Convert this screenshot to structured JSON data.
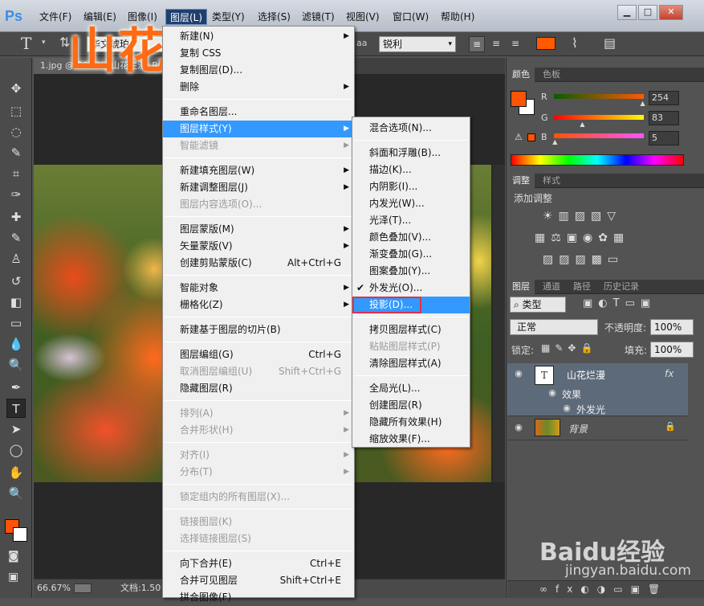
{
  "app": {
    "logo": "Ps"
  },
  "menubar": {
    "items": [
      "文件(F)",
      "编辑(E)",
      "图像(I)",
      "图层(L)",
      "类型(Y)",
      "选择(S)",
      "滤镜(T)",
      "视图(V)",
      "窗口(W)",
      "帮助(H)"
    ],
    "active_index": 3
  },
  "options": {
    "type_tool_glyph": "T",
    "font_family": "华文琥珀",
    "aa_label": "aa",
    "antialias": "锐利",
    "text_color": "#ff5a00"
  },
  "document": {
    "tab_title": "1.jpg @ 66.7% (山花烂漫, R",
    "overlay_text": "山花",
    "zoom": "66.67%",
    "doc_info": "文档:1.50"
  },
  "color_panel": {
    "tabs": [
      "颜色",
      "色板"
    ],
    "r_label": "R",
    "r_value": "254",
    "g_label": "G",
    "g_value": "83",
    "b_label": "B",
    "b_value": "5",
    "r_fraction": 0.996,
    "g_fraction": 0.325,
    "b_fraction": 0.02,
    "fg_color": "#fe5305"
  },
  "adjust_panel": {
    "tabs": [
      "调整",
      "样式"
    ],
    "title": "添加调整"
  },
  "layers_panel": {
    "tabs": [
      "图层",
      "通道",
      "路径",
      "历史记录"
    ],
    "filter_label": "类型",
    "blend_mode": "正常",
    "opacity_label": "不透明度:",
    "opacity_value": "100%",
    "lock_label": "锁定:",
    "fill_label": "填充:",
    "fill_value": "100%",
    "layers": [
      {
        "name": "山花烂漫",
        "type_glyph": "T",
        "fx": "fx"
      },
      {
        "name": "背景"
      }
    ],
    "effects_label": "效果",
    "effect_item": "外发光"
  },
  "layer_menu": {
    "items": [
      {
        "label": "新建(N)",
        "arrow": true
      },
      {
        "label": "复制 CSS"
      },
      {
        "label": "复制图层(D)..."
      },
      {
        "label": "删除",
        "arrow": true
      },
      {
        "sep": true
      },
      {
        "label": "重命名图层..."
      },
      {
        "label": "图层样式(Y)",
        "arrow": true,
        "hl": true
      },
      {
        "label": "智能滤镜",
        "arrow": true,
        "dis": true
      },
      {
        "sep": true
      },
      {
        "label": "新建填充图层(W)",
        "arrow": true
      },
      {
        "label": "新建调整图层(J)",
        "arrow": true
      },
      {
        "label": "图层内容选项(O)...",
        "dis": true
      },
      {
        "sep": true
      },
      {
        "label": "图层蒙版(M)",
        "arrow": true
      },
      {
        "label": "矢量蒙版(V)",
        "arrow": true
      },
      {
        "label": "创建剪贴蒙版(C)",
        "shortcut": "Alt+Ctrl+G"
      },
      {
        "sep": true
      },
      {
        "label": "智能对象",
        "arrow": true
      },
      {
        "label": "栅格化(Z)",
        "arrow": true
      },
      {
        "sep": true
      },
      {
        "label": "新建基于图层的切片(B)"
      },
      {
        "sep": true
      },
      {
        "label": "图层编组(G)",
        "shortcut": "Ctrl+G"
      },
      {
        "label": "取消图层编组(U)",
        "shortcut": "Shift+Ctrl+G",
        "dis": true
      },
      {
        "label": "隐藏图层(R)"
      },
      {
        "sep": true
      },
      {
        "label": "排列(A)",
        "arrow": true,
        "dis": true
      },
      {
        "label": "合并形状(H)",
        "arrow": true,
        "dis": true
      },
      {
        "sep": true
      },
      {
        "label": "对齐(I)",
        "arrow": true,
        "dis": true
      },
      {
        "label": "分布(T)",
        "arrow": true,
        "dis": true
      },
      {
        "sep": true
      },
      {
        "label": "锁定组内的所有图层(X)...",
        "dis": true
      },
      {
        "sep": true
      },
      {
        "label": "链接图层(K)",
        "dis": true
      },
      {
        "label": "选择链接图层(S)",
        "dis": true
      },
      {
        "sep": true
      },
      {
        "label": "向下合并(E)",
        "shortcut": "Ctrl+E"
      },
      {
        "label": "合并可见图层",
        "shortcut": "Shift+Ctrl+E"
      },
      {
        "label": "拼合图像(F)"
      }
    ]
  },
  "style_submenu": {
    "items": [
      {
        "label": "混合选项(N)..."
      },
      {
        "sep": true
      },
      {
        "label": "斜面和浮雕(B)..."
      },
      {
        "label": "描边(K)..."
      },
      {
        "label": "内阴影(I)..."
      },
      {
        "label": "内发光(W)..."
      },
      {
        "label": "光泽(T)..."
      },
      {
        "label": "颜色叠加(V)..."
      },
      {
        "label": "渐变叠加(G)..."
      },
      {
        "label": "图案叠加(Y)..."
      },
      {
        "label": "外发光(O)...",
        "checked": true
      },
      {
        "label": "投影(D)...",
        "hl": true,
        "boxed": true
      },
      {
        "sep": true
      },
      {
        "label": "拷贝图层样式(C)"
      },
      {
        "label": "粘贴图层样式(P)",
        "dis": true
      },
      {
        "label": "清除图层样式(A)"
      },
      {
        "sep": true
      },
      {
        "label": "全局光(L)..."
      },
      {
        "label": "创建图层(R)"
      },
      {
        "label": "隐藏所有效果(H)"
      },
      {
        "label": "缩放效果(F)..."
      }
    ]
  },
  "watermark": {
    "text": "Baidu经验",
    "url": "jingyan.baidu.com"
  },
  "icons": [
    "move-icon",
    "marquee-icon",
    "lasso-icon",
    "quick-select-icon",
    "crop-icon",
    "eyedropper-icon",
    "healing-icon",
    "brush-icon",
    "stamp-icon",
    "history-brush-icon",
    "eraser-icon",
    "gradient-icon",
    "blur-icon",
    "dodge-icon",
    "pen-icon",
    "type-icon",
    "path-select-icon",
    "ellipse-icon",
    "hand-icon",
    "zoom-icon"
  ]
}
